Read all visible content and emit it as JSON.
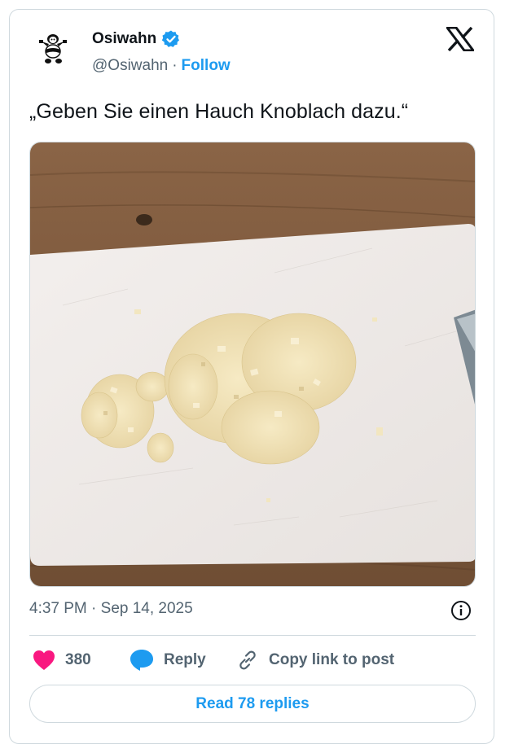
{
  "author": {
    "name": "Osiwahn",
    "handle": "@Osiwahn",
    "separator": "·",
    "follow_label": "Follow",
    "verified_icon": "verified-badge-icon",
    "avatar_icon": "panda-avatar-icon"
  },
  "platform_icon": "x-logo-icon",
  "tweet": {
    "text": "„Geben Sie einen Hauch Knoblach dazu.“",
    "image_icon": "photo-chopped-garlic-on-cutting-board"
  },
  "meta": {
    "timestamp": "4:37 PM · Sep 14, 2025",
    "info_icon": "info-icon"
  },
  "actions": {
    "like_count": "380",
    "reply_label": "Reply",
    "copy_label": "Copy link to post"
  },
  "read_replies_label": "Read 78 replies",
  "colors": {
    "accent": "#1d9bf0",
    "like": "#f91880",
    "text": "#0f1419",
    "secondary": "#536471",
    "border": "#cfd9de"
  }
}
